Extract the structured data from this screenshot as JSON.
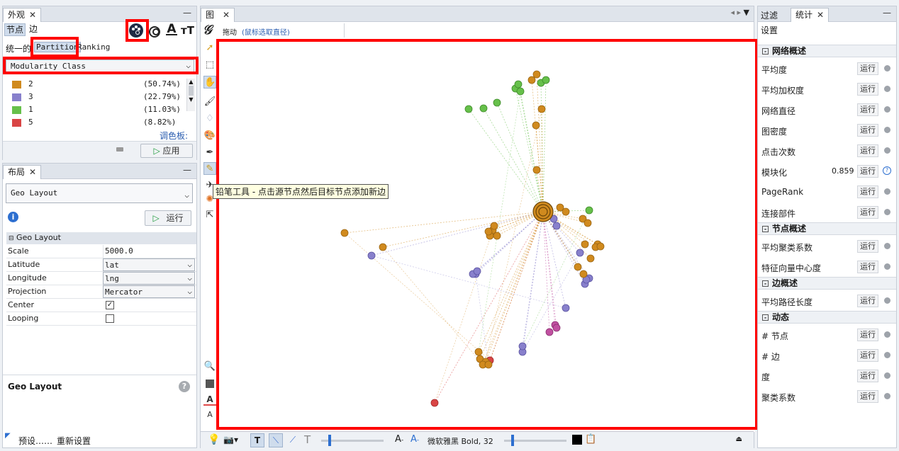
{
  "appearance": {
    "tab_title": "外观",
    "sub_tabs": [
      "节点",
      "边"
    ],
    "modes": [
      "统一的",
      "Partition",
      "Ranking"
    ],
    "attribute": "Modularity Class",
    "legend": [
      {
        "id": "2",
        "percent": "(50.74%)",
        "color": "#d08a1e"
      },
      {
        "id": "3",
        "percent": "(22.79%)",
        "color": "#8880cc"
      },
      {
        "id": "1",
        "percent": "(11.03%)",
        "color": "#66c04a"
      },
      {
        "id": "5",
        "percent": "(8.82%)",
        "color": "#d94545"
      }
    ],
    "palette_link": "调色板:",
    "apply_label": "应用"
  },
  "layout_panel": {
    "tab_title": "布局",
    "algorithm": "Geo Layout",
    "run_label": "运行",
    "group_title": "Geo Layout",
    "properties": [
      {
        "key": "Scale",
        "value": "5000.0",
        "kind": "text"
      },
      {
        "key": "Latitude",
        "value": "lat",
        "kind": "drop"
      },
      {
        "key": "Longitude",
        "value": "lng",
        "kind": "drop"
      },
      {
        "key": "Projection",
        "value": "Mercator",
        "kind": "drop"
      },
      {
        "key": "Center",
        "value": "✓",
        "kind": "check"
      },
      {
        "key": "Looping",
        "value": "",
        "kind": "check"
      }
    ],
    "description_title": "Geo Layout",
    "presets_label": "预设……",
    "reset_label": "重新设置"
  },
  "graph": {
    "tab_title": "图",
    "drag_label": "拖动",
    "hint": "(鼠标选取直径)",
    "tooltip": "铅笔工具 - 点击源节点然后目标节点添加新边",
    "font_label": "微软雅黑 Bold, 32"
  },
  "stats": {
    "tabs": [
      "过滤",
      "统计"
    ],
    "settings_label": "设置",
    "run_label": "运行",
    "sections": [
      {
        "title": "网络概述",
        "rows": [
          {
            "label": "平均度",
            "value": ""
          },
          {
            "label": "平均加权度",
            "value": ""
          },
          {
            "label": "网络直径",
            "value": ""
          },
          {
            "label": "图密度",
            "value": ""
          },
          {
            "label": "点击次数",
            "value": ""
          },
          {
            "label": "模块化",
            "value": "0.859"
          },
          {
            "label": "PageRank",
            "value": ""
          },
          {
            "label": "连接部件",
            "value": ""
          }
        ]
      },
      {
        "title": "节点概述",
        "rows": [
          {
            "label": "平均聚类系数",
            "value": ""
          },
          {
            "label": "特征向量中心度",
            "value": ""
          }
        ]
      },
      {
        "title": "边概述",
        "rows": [
          {
            "label": "平均路径长度",
            "value": ""
          }
        ]
      },
      {
        "title": "动态",
        "rows": [
          {
            "label": "# 节点",
            "value": ""
          },
          {
            "label": "# 边",
            "value": ""
          },
          {
            "label": "度",
            "value": ""
          },
          {
            "label": "聚类系数",
            "value": ""
          }
        ]
      }
    ]
  },
  "network": {
    "hub": [
      455,
      242
    ],
    "nodes": [
      [
        446,
        48,
        "orange"
      ],
      [
        452,
        60,
        "green"
      ],
      [
        459,
        56,
        "green"
      ],
      [
        416,
        68,
        "green"
      ],
      [
        423,
        72,
        "green"
      ],
      [
        420,
        62,
        "green"
      ],
      [
        439,
        56,
        "orange"
      ],
      [
        350,
        97,
        "green"
      ],
      [
        371,
        96,
        "green"
      ],
      [
        390,
        88,
        "green"
      ],
      [
        453,
        97,
        "orange"
      ],
      [
        445,
        120,
        "orange"
      ],
      [
        446,
        183,
        "orange"
      ],
      [
        175,
        272,
        "orange"
      ],
      [
        229,
        292,
        "orange"
      ],
      [
        213,
        304,
        "purple"
      ],
      [
        384,
        268,
        "orange"
      ],
      [
        390,
        276,
        "orange"
      ],
      [
        380,
        276,
        "orange"
      ],
      [
        386,
        262,
        "orange"
      ],
      [
        378,
        270,
        "orange"
      ],
      [
        360,
        330,
        "purple"
      ],
      [
        356,
        330,
        "purple"
      ],
      [
        362,
        326,
        "purple"
      ],
      [
        479,
        236,
        "orange"
      ],
      [
        487,
        242,
        "orange"
      ],
      [
        470,
        252,
        "purple"
      ],
      [
        474,
        262,
        "purple"
      ],
      [
        520,
        240,
        "green"
      ],
      [
        511,
        252,
        "orange"
      ],
      [
        518,
        258,
        "orange"
      ],
      [
        532,
        288,
        "orange"
      ],
      [
        529,
        292,
        "orange"
      ],
      [
        536,
        291,
        "orange"
      ],
      [
        514,
        288,
        "orange"
      ],
      [
        507,
        300,
        "purple"
      ],
      [
        522,
        308,
        "orange"
      ],
      [
        504,
        320,
        "orange"
      ],
      [
        520,
        336,
        "purple"
      ],
      [
        514,
        344,
        "purple"
      ],
      [
        516,
        338,
        "purple"
      ],
      [
        512,
        330,
        "orange"
      ],
      [
        487,
        378,
        "purple"
      ],
      [
        472,
        402,
        "pink"
      ],
      [
        464,
        412,
        "pink"
      ],
      [
        474,
        406,
        "pink"
      ],
      [
        426,
        440,
        "purple"
      ],
      [
        426,
        432,
        "purple"
      ],
      [
        380,
        452,
        "red"
      ],
      [
        364,
        440,
        "orange"
      ],
      [
        366,
        450,
        "orange"
      ],
      [
        374,
        454,
        "orange"
      ],
      [
        370,
        458,
        "orange"
      ],
      [
        378,
        458,
        "orange"
      ],
      [
        302,
        512,
        "red"
      ]
    ]
  }
}
